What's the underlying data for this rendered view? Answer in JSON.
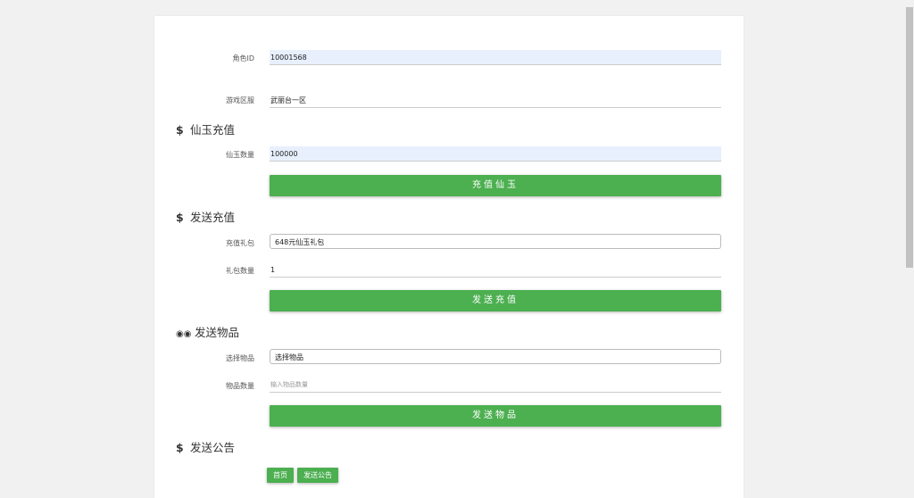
{
  "role": {
    "label": "角色ID",
    "value": "10001568"
  },
  "server": {
    "label": "游戏区服",
    "value": "武丽台一区"
  },
  "jade": {
    "heading": "仙玉充值",
    "icon": "dollar-icon",
    "qty_label": "仙玉数量",
    "qty_value": "100000",
    "button": "充值仙玉"
  },
  "recharge": {
    "heading": "发送充值",
    "icon": "dollar-icon",
    "pack_label": "充值礼包",
    "pack_value": "648元仙玉礼包",
    "qty_label": "礼包数量",
    "qty_value": "1",
    "button": "发送充值"
  },
  "items": {
    "heading": "发送物品",
    "icon": "gamepad-icon",
    "select_label": "选择物品",
    "select_value": "选择物品",
    "qty_label": "物品数量",
    "qty_placeholder": "输入物品数量",
    "button": "发送物品"
  },
  "notice": {
    "heading": "发送公告",
    "icon": "dollar-icon",
    "home_button": "首页",
    "send_button": "发送公告"
  },
  "colors": {
    "accent": "#4caf50",
    "autofill": "#e8f0fe"
  }
}
